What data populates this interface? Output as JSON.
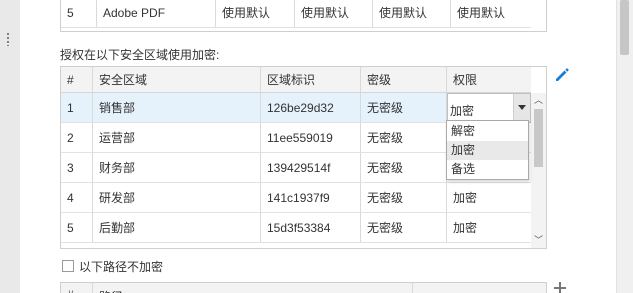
{
  "top_table": {
    "row": {
      "num": "5",
      "program": "Adobe PDF",
      "c1": "使用默认",
      "c2": "使用默认",
      "c3": "使用默认",
      "c4": "使用默认"
    }
  },
  "zone_section": {
    "label": "授权在以下安全区域使用加密:",
    "headers": {
      "num": "#",
      "zone": "安全区域",
      "zone_id": "区域标识",
      "level": "密级",
      "perm": "权限"
    },
    "rows": [
      {
        "num": "1",
        "zone": "销售部",
        "zone_id": "126be29d32",
        "level": "无密级",
        "perm": "加密"
      },
      {
        "num": "2",
        "zone": "运营部",
        "zone_id": "11ee559019",
        "level": "无密级",
        "perm": ""
      },
      {
        "num": "3",
        "zone": "财务部",
        "zone_id": "139429514f",
        "level": "无密级",
        "perm": ""
      },
      {
        "num": "4",
        "zone": "研发部",
        "zone_id": "141c1937f9",
        "level": "无密级",
        "perm": "加密"
      },
      {
        "num": "5",
        "zone": "后勤部",
        "zone_id": "15d3f53384",
        "level": "无密级",
        "perm": "加密"
      }
    ],
    "combo_value": "加密",
    "dropdown_options": [
      "解密",
      "加密",
      "备选"
    ],
    "dropdown_highlight": "加密"
  },
  "no_encrypt": {
    "label": "以下路径不加密",
    "checked": false
  },
  "path_table": {
    "headers": {
      "num": "#",
      "path": "路径"
    }
  },
  "icons": {
    "edit": "pencil-icon",
    "add": "plus-icon"
  },
  "colors": {
    "accent": "#1a7fd4",
    "selected_row": "#e5f1fb",
    "header_bg": "#f3f3f3"
  }
}
